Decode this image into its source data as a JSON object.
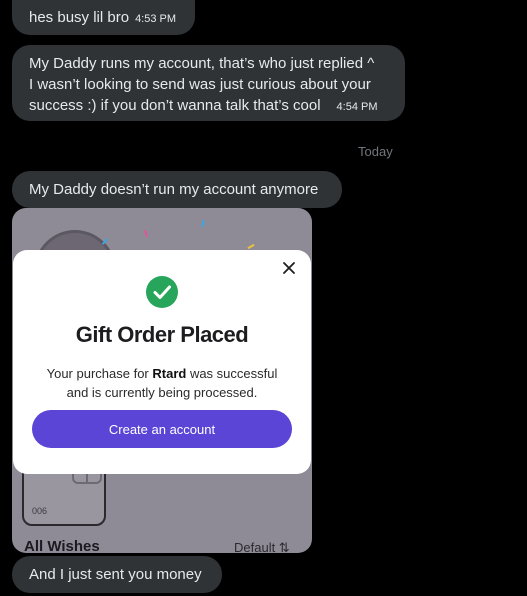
{
  "messages": [
    {
      "text": "hes busy lil bro",
      "time": "4:53 PM"
    },
    {
      "lines": [
        "My Daddy runs my account, that’s who just replied ^",
        "I wasn’t looking to send was just curious about your",
        "success :) if you don’t wanna talk that’s cool"
      ],
      "time": "4:54 PM"
    },
    {
      "text": "My Daddy doesn’t run my account anymore"
    },
    {
      "text": "And I just sent you money"
    }
  ],
  "date_divider": "Today",
  "attachment": {
    "tile_number": "006",
    "section_title": "All Wishes",
    "sort_label": "Default ⇅",
    "modal": {
      "title": "Gift Order Placed",
      "message_prefix": "Your purchase for ",
      "recipient": "Rtard",
      "message_suffix": " was successful",
      "message_line2": "and is currently being processed.",
      "button_label": "Create an account",
      "accent_color": "#5a45d6",
      "success_color": "#27a55a",
      "close_icon": "close-icon",
      "status_icon": "checkmark-icon"
    }
  }
}
